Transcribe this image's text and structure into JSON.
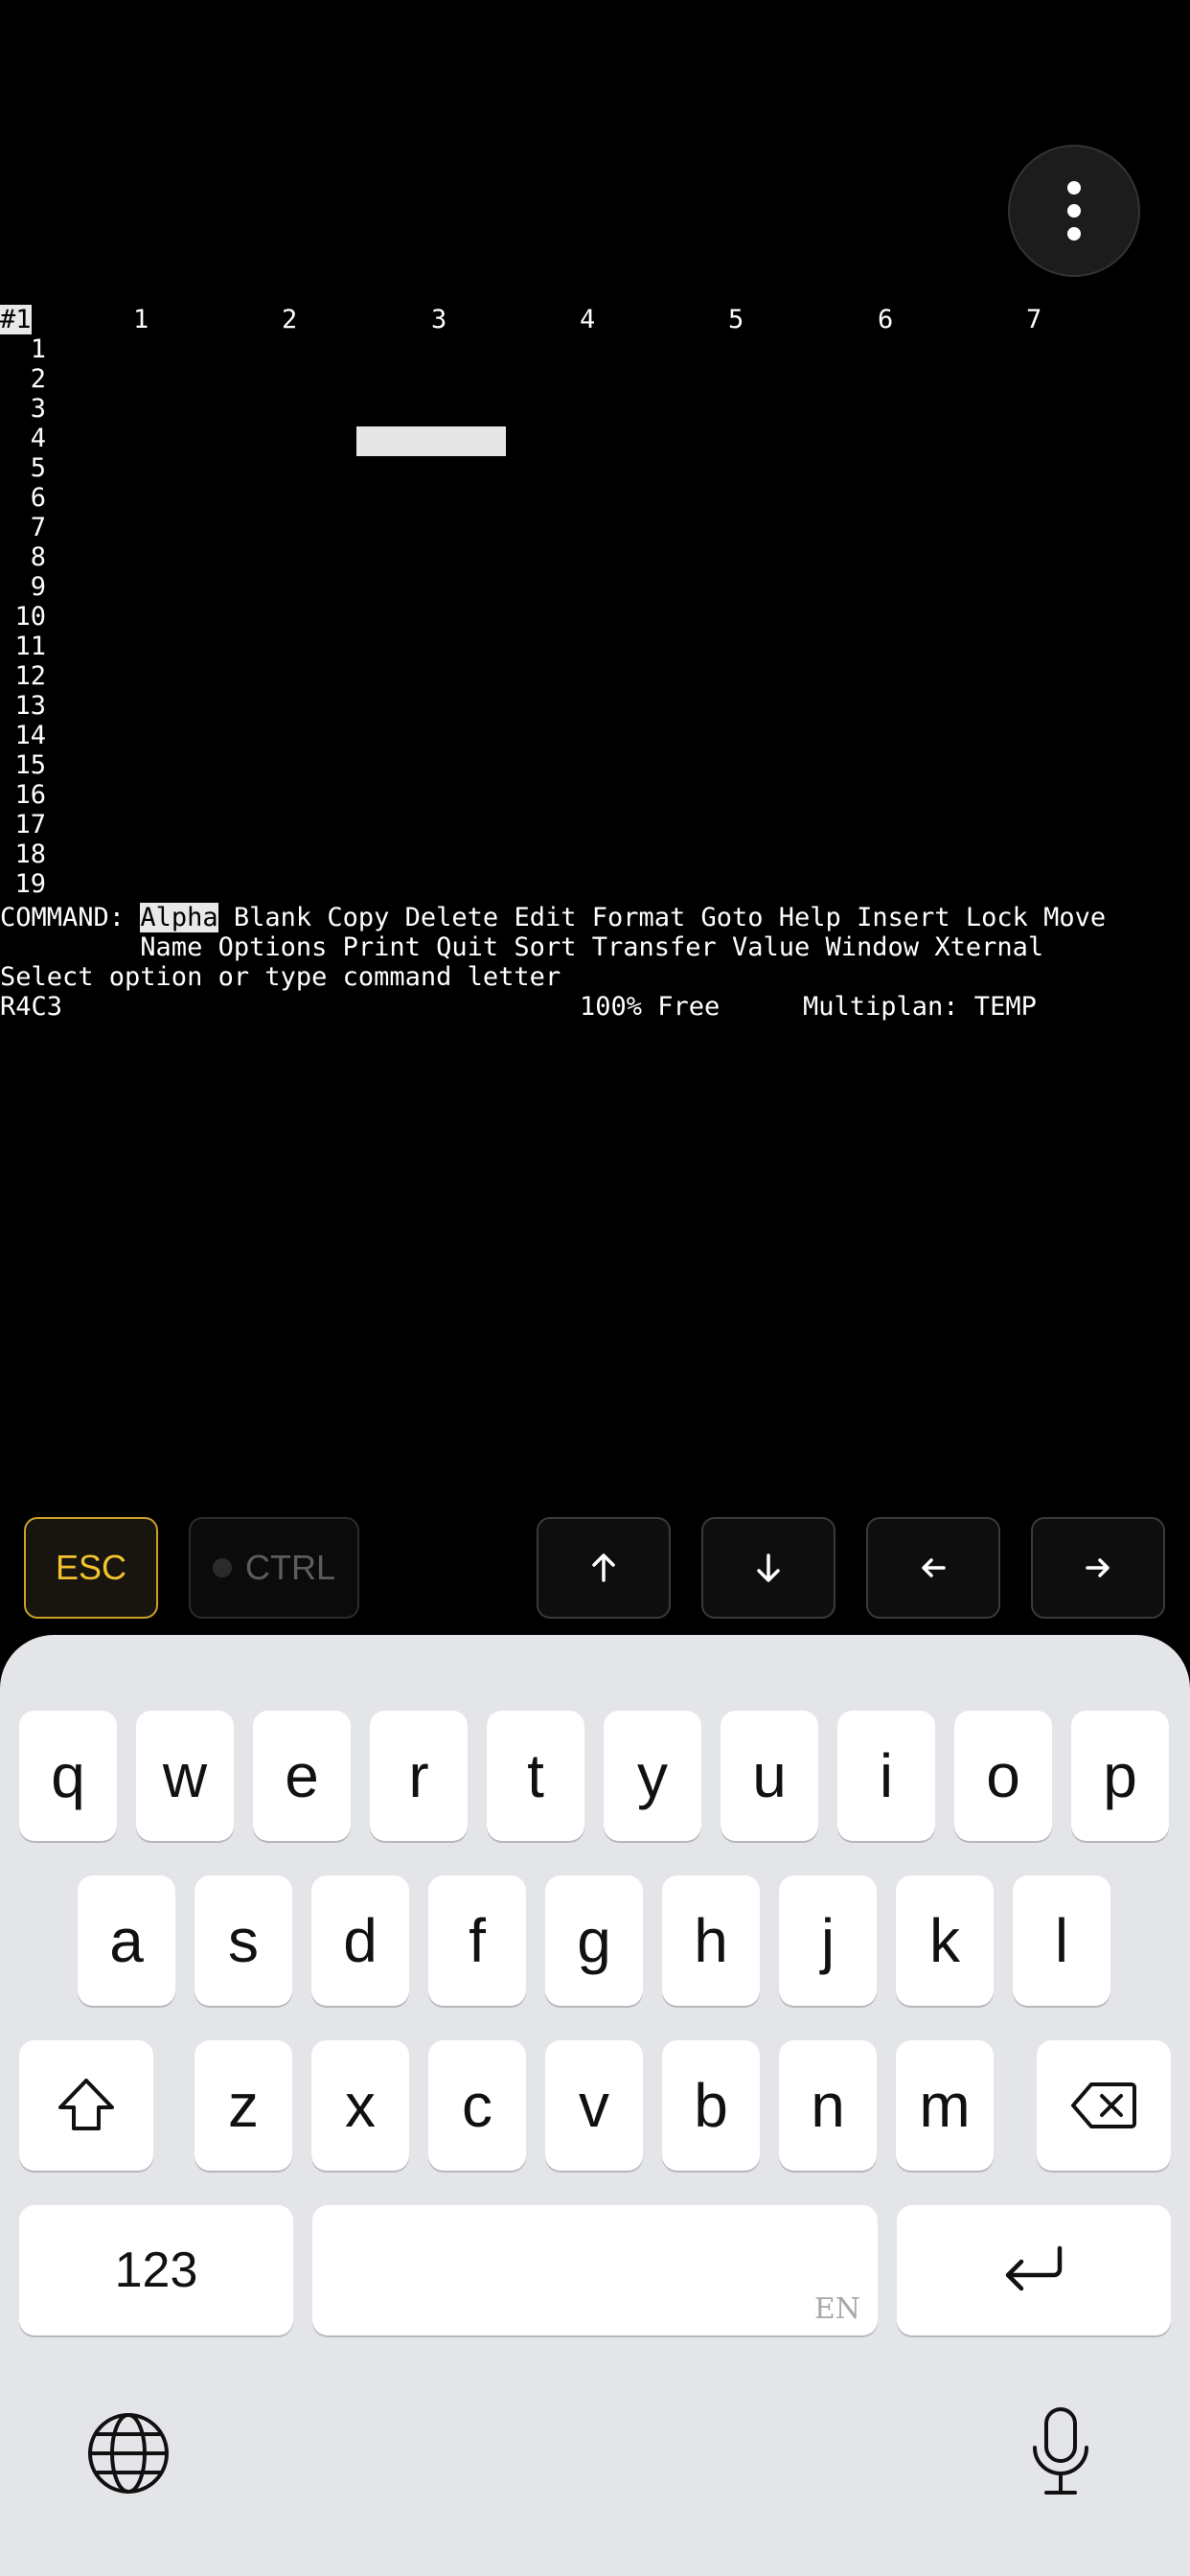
{
  "terminal": {
    "window_label": "#1",
    "columns": [
      "1",
      "2",
      "3",
      "4",
      "5",
      "6",
      "7"
    ],
    "rows": [
      "1",
      "2",
      "3",
      "4",
      "5",
      "6",
      "7",
      "8",
      "9",
      "10",
      "11",
      "12",
      "13",
      "14",
      "15",
      "16",
      "17",
      "18",
      "19"
    ],
    "command_prefix": "COMMAND: ",
    "command_selected": "Alpha",
    "command_line1_rest": " Blank Copy Delete Edit Format Goto Help Insert Lock Move",
    "command_line2": "         Name Options Print Quit Sort Transfer Value Window Xternal",
    "prompt": "Select option or type command letter",
    "cell_ref": "R4C3",
    "free": "100% Free",
    "app_file": "Multiplan: TEMP"
  },
  "accessory_bar": {
    "esc_label": "ESC",
    "ctrl_label": "CTRL",
    "up_icon": "arrow-up-icon",
    "down_icon": "arrow-down-icon",
    "left_icon": "arrow-left-icon",
    "right_icon": "arrow-right-icon",
    "esc_color": "#f2c230"
  },
  "keyboard": {
    "row1": [
      "q",
      "w",
      "e",
      "r",
      "t",
      "y",
      "u",
      "i",
      "o",
      "p"
    ],
    "row2": [
      "a",
      "s",
      "d",
      "f",
      "g",
      "h",
      "j",
      "k",
      "l"
    ],
    "row3": [
      "z",
      "x",
      "c",
      "v",
      "b",
      "n",
      "m"
    ],
    "numbers_label": "123",
    "space_lang": "EN",
    "shift_icon": "shift-icon",
    "delete_icon": "backspace-icon",
    "return_icon": "return-icon",
    "globe_icon": "globe-icon",
    "mic_icon": "microphone-icon"
  }
}
